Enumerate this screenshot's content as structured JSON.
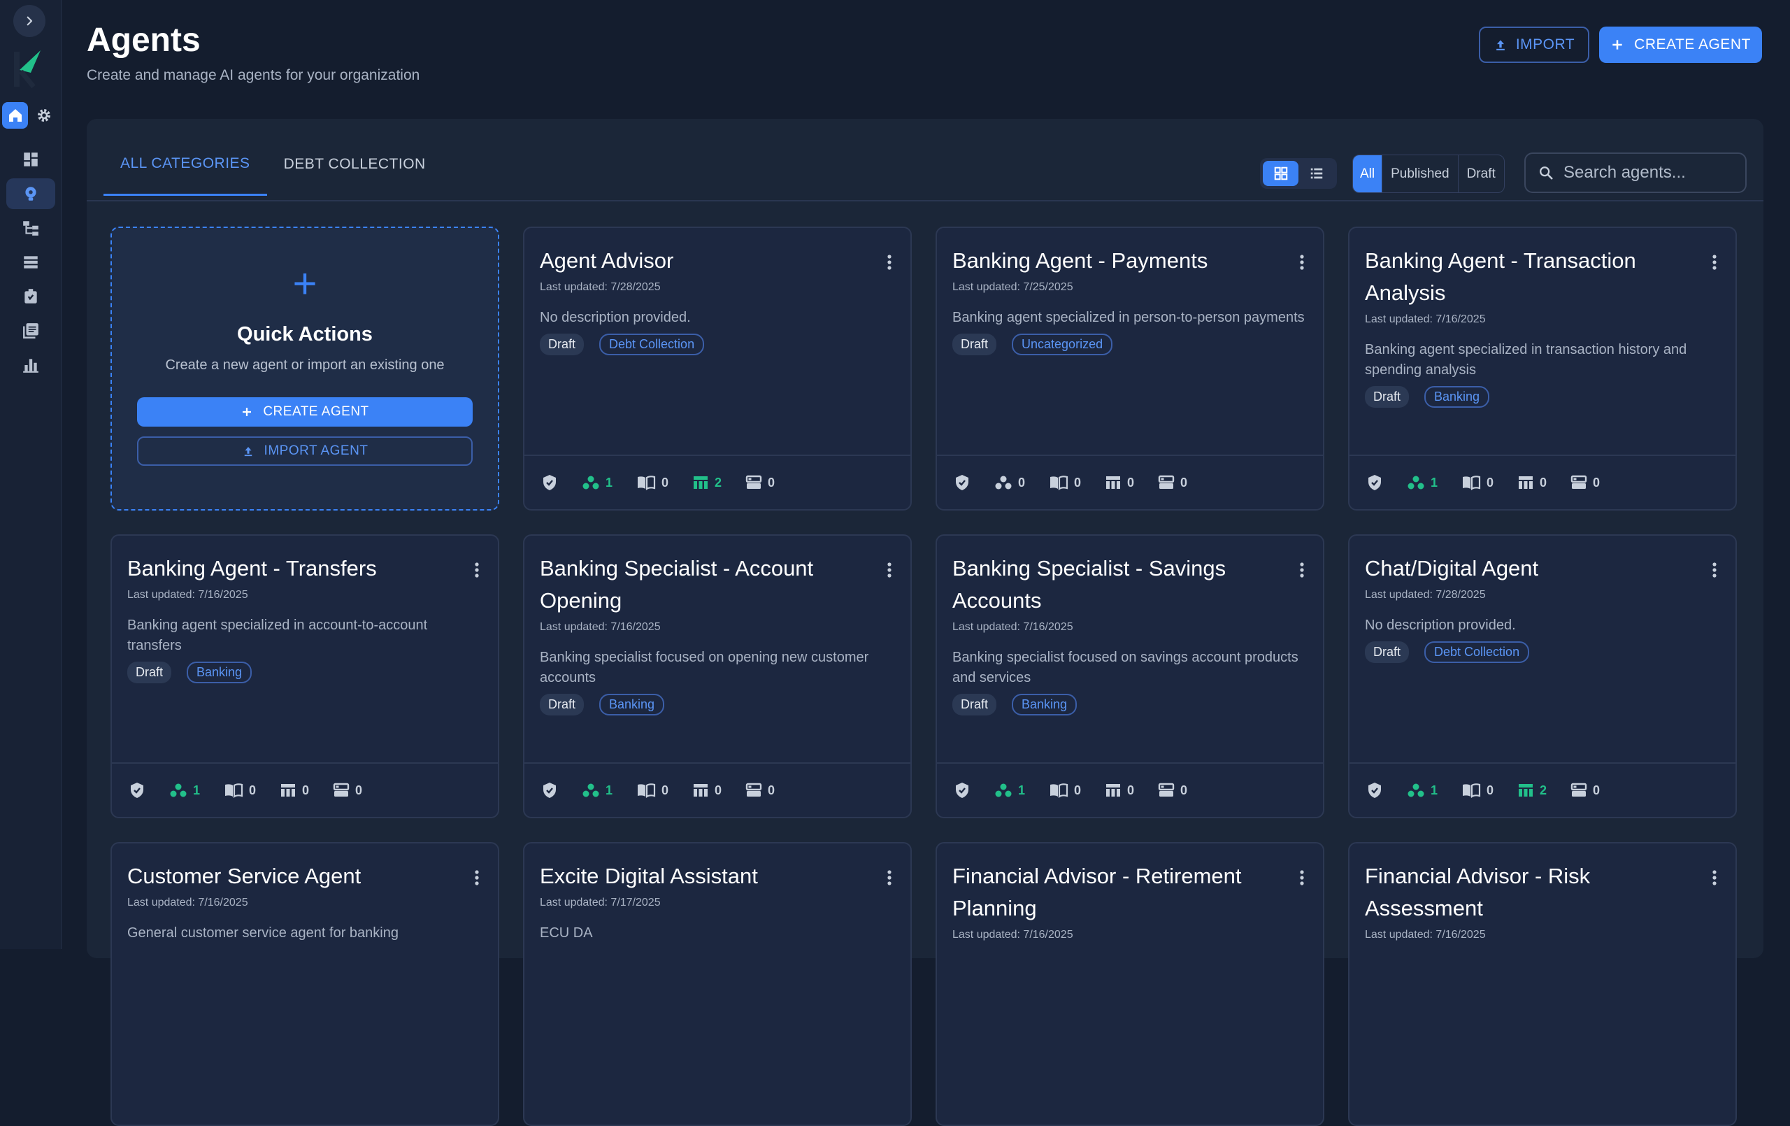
{
  "header": {
    "title": "Agents",
    "subtitle": "Create and manage AI agents for your organization",
    "import_label": "IMPORT",
    "create_label": "CREATE AGENT"
  },
  "tabs": [
    {
      "label": "ALL CATEGORIES",
      "active": true
    },
    {
      "label": "DEBT COLLECTION",
      "active": false
    }
  ],
  "status_filter": [
    "All",
    "Published",
    "Draft"
  ],
  "search": {
    "placeholder": "Search agents..."
  },
  "quick_actions": {
    "title": "Quick Actions",
    "description": "Create a new agent or import an existing one",
    "create_label": "CREATE AGENT",
    "import_label": "IMPORT AGENT"
  },
  "agents": [
    {
      "title": "Agent Advisor",
      "updated": "Last updated: 7/28/2025",
      "description": "No description provided.",
      "status": "Draft",
      "category": "Debt Collection",
      "stats": {
        "workflows": "1",
        "knowledge": "0",
        "tables": "2",
        "servers": "0"
      }
    },
    {
      "title": "Banking Agent - Payments",
      "updated": "Last updated: 7/25/2025",
      "description": "Banking agent specialized in person-to-person payments",
      "status": "Draft",
      "category": "Uncategorized",
      "stats": {
        "workflows": "0",
        "knowledge": "0",
        "tables": "0",
        "servers": "0"
      }
    },
    {
      "title": "Banking Agent - Transaction Analysis",
      "updated": "Last updated: 7/16/2025",
      "description": "Banking agent specialized in transaction history and spending analysis",
      "status": "Draft",
      "category": "Banking",
      "stats": {
        "workflows": "1",
        "knowledge": "0",
        "tables": "0",
        "servers": "0"
      }
    },
    {
      "title": "Banking Agent - Transfers",
      "updated": "Last updated: 7/16/2025",
      "description": "Banking agent specialized in account-to-account transfers",
      "status": "Draft",
      "category": "Banking",
      "stats": {
        "workflows": "1",
        "knowledge": "0",
        "tables": "0",
        "servers": "0"
      }
    },
    {
      "title": "Banking Specialist - Account Opening",
      "updated": "Last updated: 7/16/2025",
      "description": "Banking specialist focused on opening new customer accounts",
      "status": "Draft",
      "category": "Banking",
      "stats": {
        "workflows": "1",
        "knowledge": "0",
        "tables": "0",
        "servers": "0"
      }
    },
    {
      "title": "Banking Specialist - Savings Accounts",
      "updated": "Last updated: 7/16/2025",
      "description": "Banking specialist focused on savings account products and services",
      "status": "Draft",
      "category": "Banking",
      "stats": {
        "workflows": "1",
        "knowledge": "0",
        "tables": "0",
        "servers": "0"
      }
    },
    {
      "title": "Chat/Digital Agent",
      "updated": "Last updated: 7/28/2025",
      "description": "No description provided.",
      "status": "Draft",
      "category": "Debt Collection",
      "stats": {
        "workflows": "1",
        "knowledge": "0",
        "tables": "2",
        "servers": "0"
      }
    },
    {
      "title": "Customer Service Agent",
      "updated": "Last updated: 7/16/2025",
      "description": "General customer service agent for banking",
      "status": "",
      "category": "",
      "stats": null
    },
    {
      "title": "Excite Digital Assistant",
      "updated": "Last updated: 7/17/2025",
      "description": "ECU DA",
      "status": "",
      "category": "",
      "stats": null
    },
    {
      "title": "Financial Advisor - Retirement Planning",
      "updated": "Last updated: 7/16/2025",
      "description": "",
      "status": "",
      "category": "",
      "stats": null
    },
    {
      "title": "Financial Advisor - Risk Assessment",
      "updated": "Last updated: 7/16/2025",
      "description": "",
      "status": "",
      "category": "",
      "stats": null
    }
  ],
  "colors": {
    "accent": "#3b82f6",
    "background": "#141d2e",
    "card": "#1c2740",
    "stat_active": "#22c08a"
  },
  "icons": [
    "chevron-right-icon",
    "home-icon",
    "gear-icon",
    "dashboard-icon",
    "agent-icon",
    "workflow-icon",
    "list-icon",
    "integration-icon",
    "library-icon",
    "chart-icon",
    "upload-icon",
    "plus-icon",
    "grid-view-icon",
    "list-view-icon",
    "search-icon",
    "more-vert-icon",
    "shield-icon",
    "people-icon",
    "book-icon",
    "table-icon",
    "server-icon"
  ]
}
